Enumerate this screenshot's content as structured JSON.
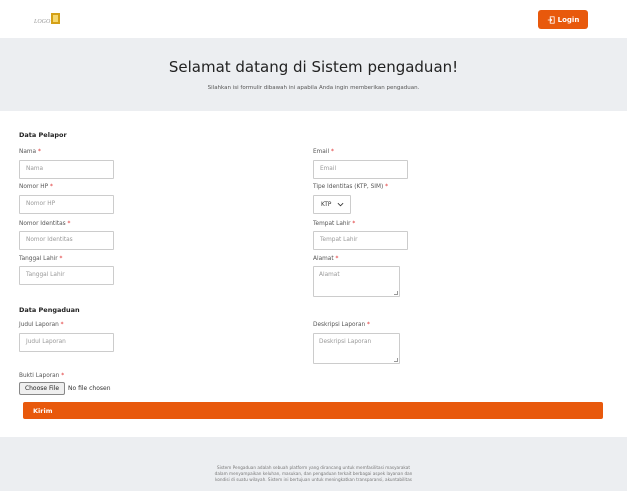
{
  "navbar": {
    "logo_alt": "Logo",
    "login_label": "Login",
    "login_color": "#e8590c"
  },
  "hero": {
    "title": "Selamat datang di Sistem pengaduan!",
    "subtitle": "Silahkan isi formulir dibawah ini apabila Anda ingin memberikan pengaduan."
  },
  "form": {
    "pelapor_title": "Data Pelapor",
    "nama": {
      "label": "Nama",
      "placeholder": "Nama"
    },
    "email": {
      "label": "Email",
      "placeholder": "Email"
    },
    "nomor_hp": {
      "label": "Nomor HP",
      "placeholder": "Nomor HP"
    },
    "tipe_identitas": {
      "label": "Tipe Identitas (KTP, SIM)",
      "value": "KTP"
    },
    "nomor_identitas": {
      "label": "Nomor Identitas",
      "placeholder": "Nomor Identitas"
    },
    "tempat_lahir": {
      "label": "Tempat Lahir",
      "placeholder": "Tempat Lahir"
    },
    "tanggal_lahir": {
      "label": "Tanggal Lahir",
      "placeholder": "Tanggal Lahir"
    },
    "alamat": {
      "label": "Alamat",
      "placeholder": "Alamat"
    },
    "pengaduan_title": "Data Pengaduan",
    "judul_laporan": {
      "label": "Judul Laporan",
      "placeholder": "Judul Laporan"
    },
    "deskripsi_laporan": {
      "label": "Deskripsi Laporan",
      "placeholder": "Deskripsi Laporan"
    },
    "bukti_laporan": {
      "label": "Bukti Laporan",
      "button": "Choose File",
      "status": "No file chosen"
    },
    "required_mark": "*",
    "submit_label": "Kirim"
  },
  "footer": {
    "line1": "Sistem Pengaduan adalah sebuah platform yang dirancang untuk memfasilitasi masyarakat",
    "line2": "dalam menyampaikan keluhan, masukan, dan pengaduan terkait berbagai aspek layanan dan",
    "line3": "kondisi di suatu wilayah. Sistem ini bertujuan untuk meningkatkan transparansi, akuntabilitas"
  }
}
